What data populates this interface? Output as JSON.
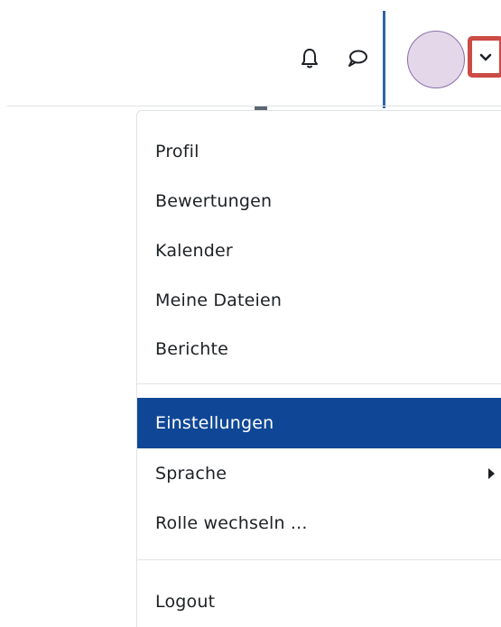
{
  "navbar": {
    "icons": [
      "bell-icon",
      "chat-bubble-icon"
    ],
    "avatar_color": "#e4d7ea",
    "toggle_icon": "chevron-down-icon",
    "focus_color": "#2f62a7",
    "toggle_outline_color": "#cb4b45"
  },
  "user_menu": {
    "items": [
      {
        "label": "Profil"
      },
      {
        "label": "Bewertungen"
      },
      {
        "label": "Kalender"
      },
      {
        "label": "Meine Dateien"
      },
      {
        "label": "Berichte"
      },
      {
        "label": "Einstellungen",
        "active": true
      },
      {
        "label": "Sprache",
        "has_submenu": true
      },
      {
        "label": "Rolle wechseln ..."
      },
      {
        "label": "Logout"
      }
    ],
    "active_color": "#0f4796"
  }
}
